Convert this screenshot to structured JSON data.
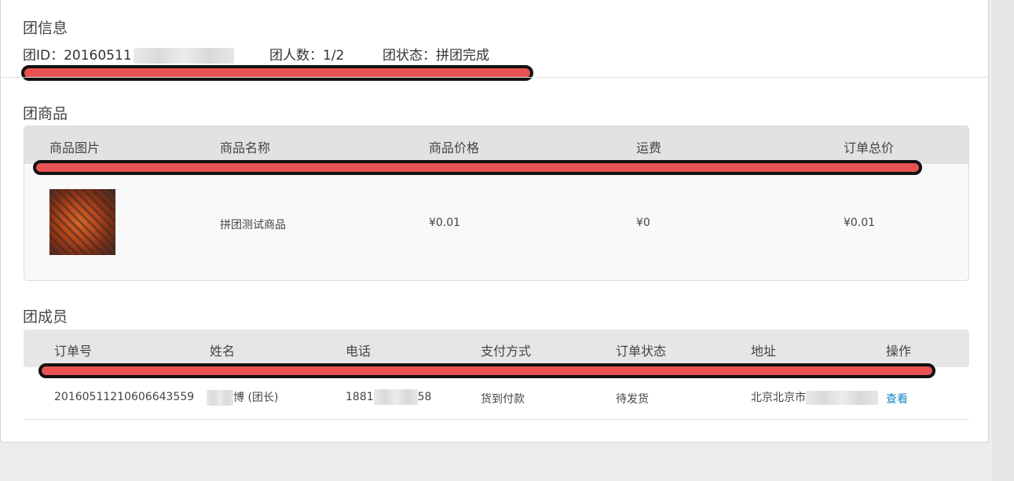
{
  "group_info": {
    "title": "团信息",
    "id_label": "团ID：20160511",
    "members_label": "团人数：1/2",
    "status_label": "团状态：拼团完成"
  },
  "group_goods": {
    "title": "团商品",
    "columns": [
      "商品图片",
      "商品名称",
      "商品价格",
      "运费",
      "订单总价"
    ],
    "row": {
      "name": "拼团测试商品",
      "price": "¥0.01",
      "shipping": "¥0",
      "total": "¥0.01"
    }
  },
  "group_members": {
    "title": "团成员",
    "columns": [
      "订单号",
      "姓名",
      "电话",
      "支付方式",
      "订单状态",
      "地址",
      "操作"
    ],
    "rows": [
      {
        "order_no": "20160511210606643559",
        "name_suffix": "博 (团长)",
        "phone_prefix": "1881",
        "phone_suffix": "58",
        "payment": "货到付款",
        "status": "待发货",
        "address_prefix": "北京北京市",
        "action": "查看"
      }
    ]
  },
  "colors": {
    "link": "#1a84c7",
    "redaction_fill": "#e85252",
    "redaction_border": "#111111"
  }
}
